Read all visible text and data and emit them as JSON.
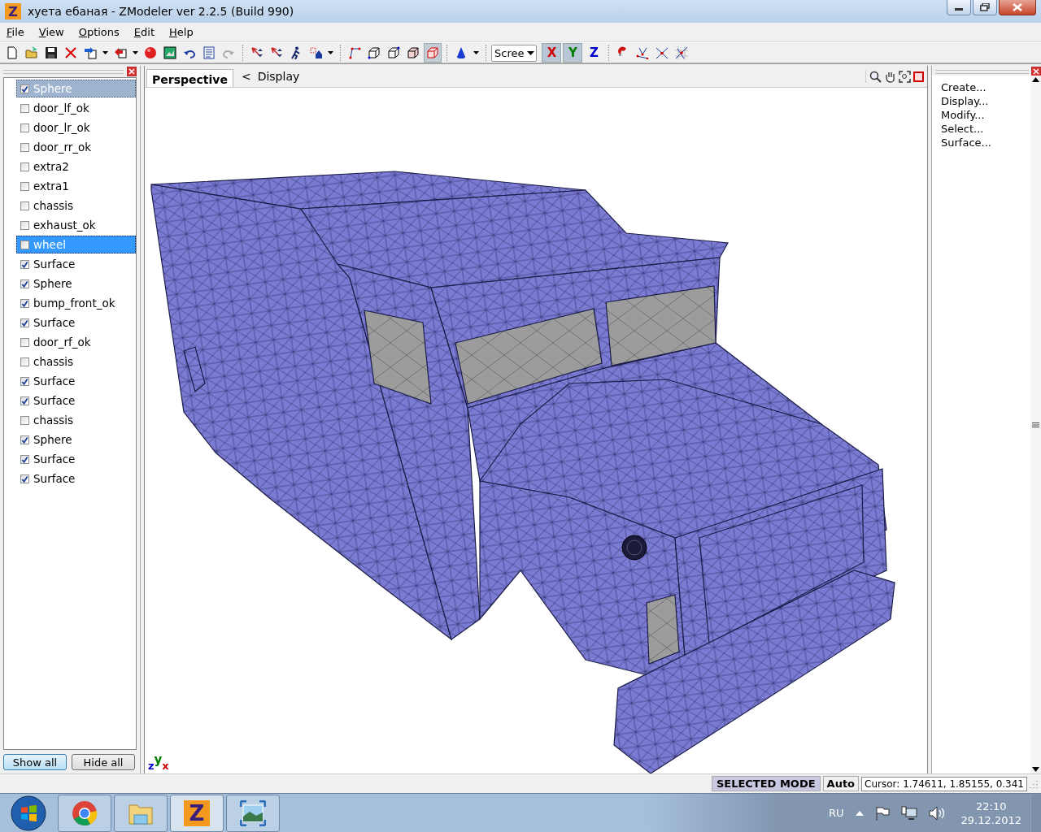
{
  "window": {
    "logo": "Z",
    "title": "хуета ебаная - ZModeler ver 2.2.5 (Build 990)"
  },
  "menu": [
    {
      "label": "File"
    },
    {
      "label": "View"
    },
    {
      "label": "Options"
    },
    {
      "label": "Edit"
    },
    {
      "label": "Help"
    }
  ],
  "toolbar": {
    "view_tools": [
      {
        "selected": false
      },
      {
        "selected": false
      },
      {
        "selected": false
      },
      {
        "selected": false
      },
      {
        "selected": true
      }
    ],
    "coordinate_system": "Scree",
    "axes": [
      {
        "label": "X",
        "selected": true,
        "color": "#cc0000"
      },
      {
        "label": "Y",
        "selected": true,
        "color": "#008000"
      },
      {
        "label": "Z",
        "selected": false,
        "color": "#0000cc"
      }
    ]
  },
  "objects": [
    {
      "label": "Sphere",
      "checked": true,
      "selected": true,
      "focused": false
    },
    {
      "label": "door_lf_ok",
      "checked": false,
      "selected": false,
      "focused": false
    },
    {
      "label": "door_lr_ok",
      "checked": false,
      "selected": false,
      "focused": false
    },
    {
      "label": "door_rr_ok",
      "checked": false,
      "selected": false,
      "focused": false
    },
    {
      "label": "extra2",
      "checked": false,
      "selected": false,
      "focused": false
    },
    {
      "label": "extra1",
      "checked": false,
      "selected": false,
      "focused": false
    },
    {
      "label": "chassis",
      "checked": false,
      "selected": false,
      "focused": false
    },
    {
      "label": "exhaust_ok",
      "checked": false,
      "selected": false,
      "focused": false
    },
    {
      "label": "wheel",
      "checked": false,
      "selected": true,
      "focused": true
    },
    {
      "label": "Surface",
      "checked": true,
      "selected": false,
      "focused": false
    },
    {
      "label": "Sphere",
      "checked": true,
      "selected": false,
      "focused": false
    },
    {
      "label": "bump_front_ok",
      "checked": true,
      "selected": false,
      "focused": false
    },
    {
      "label": "Surface",
      "checked": true,
      "selected": false,
      "focused": false
    },
    {
      "label": "door_rf_ok",
      "checked": false,
      "selected": false,
      "focused": false
    },
    {
      "label": "chassis",
      "checked": false,
      "selected": false,
      "focused": false
    },
    {
      "label": "Surface",
      "checked": true,
      "selected": false,
      "focused": false
    },
    {
      "label": "Surface",
      "checked": true,
      "selected": false,
      "focused": false
    },
    {
      "label": "chassis",
      "checked": false,
      "selected": false,
      "focused": false
    },
    {
      "label": "Sphere",
      "checked": true,
      "selected": false,
      "focused": false
    },
    {
      "label": "Surface",
      "checked": true,
      "selected": false,
      "focused": false
    },
    {
      "label": "Surface",
      "checked": true,
      "selected": false,
      "focused": false
    }
  ],
  "list_buttons": [
    {
      "label": "Show all",
      "default": true
    },
    {
      "label": "Hide all",
      "default": false
    }
  ],
  "viewport": {
    "tab": "Perspective",
    "back": "<",
    "panel": "Display",
    "gizmo": [
      {
        "label": "z",
        "color": "#0000cc"
      },
      {
        "label": "y",
        "color": "#008000"
      },
      {
        "label": "x",
        "color": "#cc0000"
      }
    ]
  },
  "command_panel": [
    "Create...",
    "Display...",
    "Modify...",
    "Select...",
    "Surface..."
  ],
  "status_bar": {
    "mode": "SELECTED MODE",
    "snap": "Auto",
    "cursor": "Cursor: 1.74611, 1.85155, 0.341"
  },
  "taskbar": {
    "apps": [
      {
        "kind": "browser",
        "selected": false
      },
      {
        "kind": "folder",
        "selected": false
      },
      {
        "kind": "modeler",
        "selected": true,
        "logo": "Z"
      },
      {
        "kind": "photos",
        "selected": false
      }
    ],
    "language": "RU",
    "time": "22:10",
    "date": "29.12.2012"
  }
}
